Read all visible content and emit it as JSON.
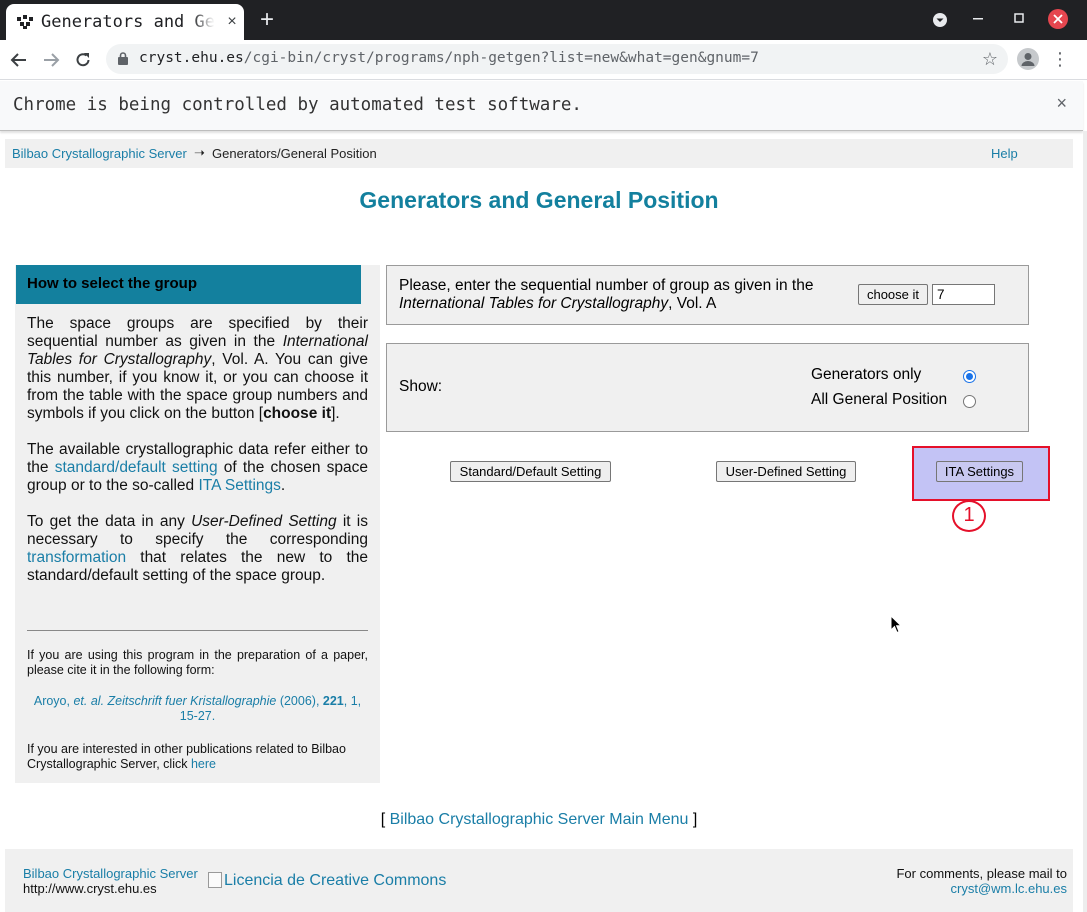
{
  "browser": {
    "tab_title": "Generators and General Position",
    "tab_close": "×",
    "new_tab": "+",
    "url_host": "cryst.ehu.es",
    "url_path": "/cgi-bin/cryst/programs/nph-getgen?list=new&what=gen&gnum=7",
    "infobar_text": "Chrome is being controlled by automated test software.",
    "infobar_close": "×",
    "icons": [
      "back-icon",
      "forward-icon",
      "reload-icon",
      "lock-icon",
      "star-icon",
      "avatar-icon",
      "menu-icon"
    ]
  },
  "breadcrumb": {
    "home": "Bilbao Crystallographic Server",
    "arrow": "➝",
    "current": "Generators/General Position",
    "help": "Help"
  },
  "page": {
    "title": "Generators and General Position"
  },
  "left_panel": {
    "heading": "How to select the group",
    "p1_a": "The space groups are specified by their sequential number as given in the ",
    "p1_b": "International Tables for Crystallography",
    "p1_c": ", Vol. A. You can give this number, if you know it, or you can choose it from the table with the space group numbers and symbols if you click on the button [",
    "p1_d": "choose it",
    "p1_e": "].",
    "p2_a": "The available crystallographic data refer either to the ",
    "p2_link1": "standard/default setting",
    "p2_b": " of the chosen space group or to the so-called ",
    "p2_link2": "ITA Settings",
    "p2_c": ".",
    "p3_a": "To get the data in any ",
    "p3_b": "User-Defined Setting",
    "p3_c": " it is necessary to specify the corresponding ",
    "p3_link": "transformation",
    "p3_d": " that relates the new to the standard/default setting of the space group.",
    "cite_note": "If you are using this program in the preparation of a paper, please cite it in the following form:",
    "cite_a": "Aroyo, ",
    "cite_b": "et. al. Zeitschrift fuer Kristallographie",
    "cite_c": " (2006), ",
    "cite_d": "221",
    "cite_e": ", 1, 15-27.",
    "other_pubs": "If you are interested in other publications related to Bilbao Crystallographic Server, click ",
    "here": "here"
  },
  "group_box": {
    "text_a": "Please, enter the sequential number of group as given in the ",
    "text_b": "International Tables for Crystallography",
    "text_c": ", Vol. A",
    "choose_label": "choose it",
    "number_value": "7"
  },
  "show_box": {
    "label": "Show:",
    "option1": "Generators only",
    "option2": "All General Position",
    "selected": "Generators only"
  },
  "actions": {
    "standard": "Standard/Default Setting",
    "user": "User-Defined Setting",
    "ita": "ITA Settings",
    "marker": "1"
  },
  "main_menu": {
    "open": "[ ",
    "link": "Bilbao Crystallographic Server Main Menu",
    "close": " ]"
  },
  "footer": {
    "server": "Bilbao Crystallographic Server",
    "site": "http://www.cryst.ehu.es",
    "cc_alt": "Licencia de Creative Commons",
    "comments": "For comments, please mail to",
    "email": "cryst@wm.lc.ehu.es"
  }
}
